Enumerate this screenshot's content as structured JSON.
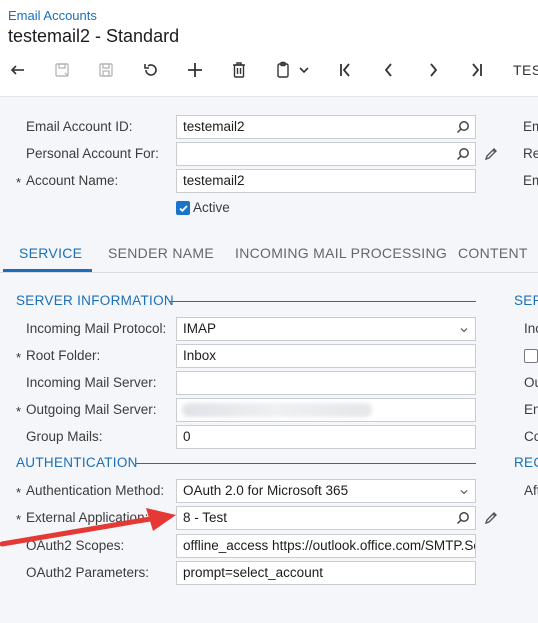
{
  "header": {
    "breadcrumb": "Email Accounts",
    "title": "testemail2 - Standard",
    "toolbar_trailing_text": "TES"
  },
  "icons": {
    "back": "undo-arrow-icon",
    "save_close": "save-close-icon",
    "save": "save-icon",
    "cancel": "revert-icon",
    "add": "plus-icon",
    "delete": "trash-icon",
    "copy_paste": "clipboard-icon",
    "first": "first-record-icon",
    "prev": "previous-record-icon",
    "next": "next-record-icon",
    "last": "last-record-icon"
  },
  "summary": {
    "email_account_id": {
      "label": "Email Account ID:",
      "value": "testemail2"
    },
    "personal_account_for": {
      "label": "Personal Account For:",
      "value": ""
    },
    "account_name": {
      "label": "Account Name:",
      "value": "testemail2"
    },
    "active": {
      "label": "Active",
      "checked": true
    },
    "right_labels": [
      "Em",
      "Re",
      "Em"
    ]
  },
  "tabs": [
    {
      "label": "SERVICE",
      "active": true
    },
    {
      "label": "SENDER NAME",
      "active": false
    },
    {
      "label": "INCOMING MAIL PROCESSING",
      "active": false
    },
    {
      "label": "CONTENT",
      "active": false
    }
  ],
  "server_information": {
    "title": "SERVER INFORMATION",
    "incoming_mail_protocol": {
      "label": "Incoming Mail Protocol:",
      "value": "IMAP"
    },
    "root_folder": {
      "label": "Root Folder:",
      "value": "Inbox"
    },
    "incoming_mail_server": {
      "label": "Incoming Mail Server:",
      "value": ""
    },
    "outgoing_mail_server": {
      "label": "Outgoing Mail Server:",
      "value": ""
    },
    "group_mails": {
      "label": "Group Mails:",
      "value": "0"
    }
  },
  "authentication": {
    "title": "AUTHENTICATION",
    "authentication_method": {
      "label": "Authentication Method:",
      "value": "OAuth 2.0 for Microsoft 365"
    },
    "external_application": {
      "label": "External Application:",
      "value": "8 - Test"
    },
    "oauth2_scopes": {
      "label": "OAuth2 Scopes:",
      "value": "offline_access https://outlook.office.com/SMTP.Se"
    },
    "oauth2_parameters": {
      "label": "OAuth2 Parameters:",
      "value": "prompt=select_account"
    }
  },
  "right_column": {
    "section_1": "SER",
    "section_2": "REC",
    "labels": [
      "Inc",
      "Ou",
      "En",
      "Co",
      "Aft"
    ]
  },
  "colors": {
    "accent": "#1a6fb8",
    "annotation_arrow": "#e53935",
    "panel_bg": "#f4f6f9"
  }
}
